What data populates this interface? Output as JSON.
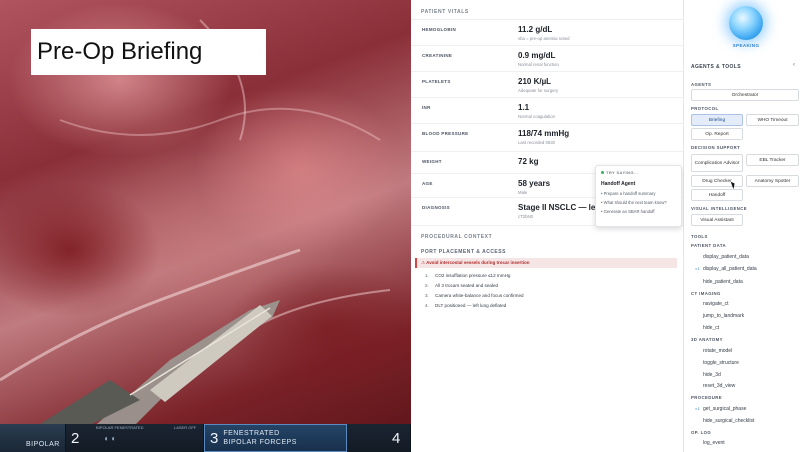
{
  "overlay": {
    "title": "Pre-Op Briefing"
  },
  "instruments": [
    {
      "num": "",
      "label": "BIPOLAR"
    },
    {
      "num": "2",
      "label": "",
      "tiny": "BIPOLAR FENESTRATED",
      "tiny2": "LASER OFF"
    },
    {
      "num": "3",
      "label1": "FENESTRATED",
      "label2": "BIPOLAR FORCEPS"
    },
    {
      "num": "4",
      "label": ""
    }
  ],
  "vitals": {
    "header": "PATIENT VITALS",
    "rows": [
      {
        "label": "HEMOGLOBIN",
        "value": "11.2 g/dL",
        "sub": "vba = pre-op anemia noted"
      },
      {
        "label": "CREATININE",
        "value": "0.9 mg/dL",
        "sub": "Normal renal function"
      },
      {
        "label": "PLATELETS",
        "value": "210 K/µL",
        "sub": "Adequate for surgery"
      },
      {
        "label": "INR",
        "value": "1.1",
        "sub": "Normal coagulation"
      },
      {
        "label": "BLOOD PRESSURE",
        "value": "118/74 mmHg",
        "sub": "Last recorded 0630"
      },
      {
        "label": "WEIGHT",
        "value": "72 kg",
        "sub": ""
      },
      {
        "label": "AGE",
        "value": "58 years",
        "sub": "Male"
      },
      {
        "label": "DIAGNOSIS",
        "value": "Stage II NSCLC — left up",
        "sub": "cT2bN0"
      }
    ]
  },
  "procedure": {
    "context_header": "PROCEDURAL CONTEXT",
    "section_header": "PORT PLACEMENT & ACCESS",
    "warning": "Avoid intercostal vessels during trocar insertion",
    "steps": [
      {
        "n": "1.",
        "text": "CO2 insufflation pressure ≤12 mmHg"
      },
      {
        "n": "2.",
        "text": "All 3 trocars seated and sealed"
      },
      {
        "n": "3.",
        "text": "Camera white-balance and focus confirmed"
      },
      {
        "n": "4.",
        "text": "DLT positioned — left lung deflated"
      }
    ]
  },
  "popup": {
    "header": "TRY SAYING...",
    "title": "Handoff Agent",
    "items": [
      "Prepare a handoff summary",
      "What should the next team know?",
      "Generate an SBAR handoff"
    ]
  },
  "agents": {
    "status": "SPEAKING",
    "header": "AGENTS & TOOLS",
    "collapse": "‹",
    "agents_label": "AGENTS",
    "orchestrator": "Orchestrator",
    "protocol_label": "PROTOCOL",
    "protocol": [
      "Briefing",
      "WHO Timeout",
      "Op. Report"
    ],
    "decision_label": "DECISION SUPPORT",
    "decision": [
      "Complication Advisor",
      "EBL Tracker",
      "Drug Checker",
      "Anatomy Spotter",
      "Handoff"
    ],
    "visual_label": "VISUAL INTELLIGENCE",
    "visual": [
      "Visual Assistant"
    ]
  },
  "tools": {
    "header": "TOOLS",
    "groups": [
      {
        "name": "PATIENT DATA",
        "items": [
          {
            "name": "display_patient_data",
            "mark": ""
          },
          {
            "name": "display_all_patient_data",
            "mark": "×1"
          },
          {
            "name": "hide_patient_data",
            "mark": ""
          }
        ]
      },
      {
        "name": "CT IMAGING",
        "items": [
          {
            "name": "navigate_ct",
            "mark": ""
          },
          {
            "name": "jump_to_landmark",
            "mark": ""
          },
          {
            "name": "hide_ct",
            "mark": ""
          }
        ]
      },
      {
        "name": "3D ANATOMY",
        "items": [
          {
            "name": "rotate_model",
            "mark": ""
          },
          {
            "name": "toggle_structure",
            "mark": ""
          },
          {
            "name": "hide_3d",
            "mark": ""
          },
          {
            "name": "reset_3d_view",
            "mark": ""
          }
        ]
      },
      {
        "name": "PROCEDURE",
        "items": [
          {
            "name": "get_surgical_phase",
            "mark": "×1"
          },
          {
            "name": "hide_surgical_checklist",
            "mark": ""
          }
        ]
      },
      {
        "name": "OP. LOG",
        "items": [
          {
            "name": "log_event",
            "mark": ""
          }
        ]
      }
    ]
  },
  "colors": {
    "accent": "#2e7fcf",
    "warning": "#d04747",
    "active_chip": "#e3ecf8"
  }
}
